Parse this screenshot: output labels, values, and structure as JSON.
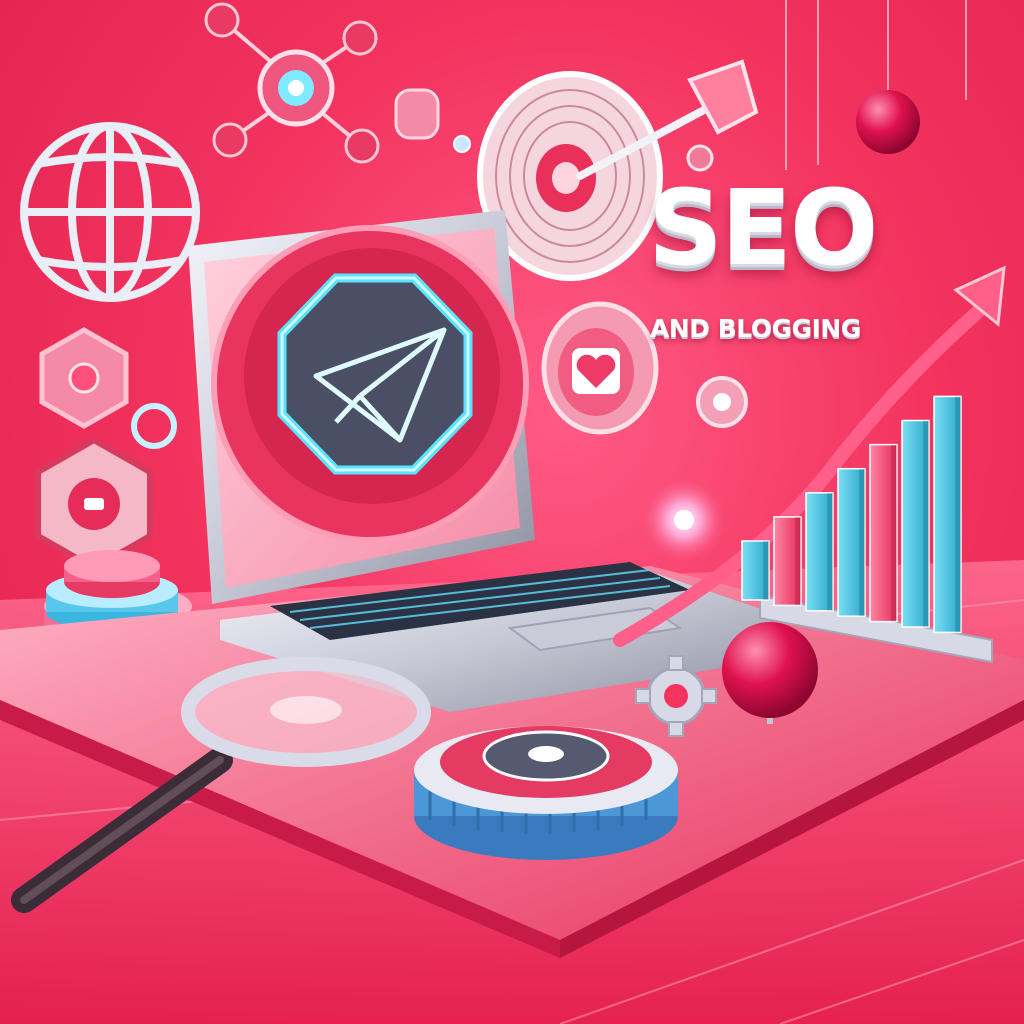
{
  "headline": {
    "title": "SEO",
    "subtitle": "AND BLOGGING"
  },
  "icons": [
    "globe-icon",
    "network-node-icon",
    "target-icon",
    "arrow-dart-icon",
    "paper-plane-icon",
    "heart-icon",
    "gear-icon",
    "magnifier-icon",
    "hexagon-badge-icon",
    "trend-arrow-icon"
  ],
  "colors": {
    "background": "#f3345f",
    "accent_pink": "#ff2a6d",
    "accent_cyan": "#3ec8e6",
    "silver": "#d9dbe6",
    "white": "#ffffff"
  },
  "chart_data": {
    "type": "bar",
    "categories": [
      "",
      "",
      "",
      "",
      "",
      "",
      ""
    ],
    "series": [
      {
        "values": [
          2,
          3,
          4,
          5,
          6,
          7,
          8
        ]
      }
    ],
    "bar_colors": [
      "#46c6e0",
      "#ff4b7a",
      "#46c6e0",
      "#46c6e0",
      "#ff4b7a",
      "#46c6e0",
      "#46c6e0"
    ],
    "trend": "rising",
    "title": "",
    "xlabel": "",
    "ylabel": "",
    "ylim": [
      0,
      8
    ]
  }
}
